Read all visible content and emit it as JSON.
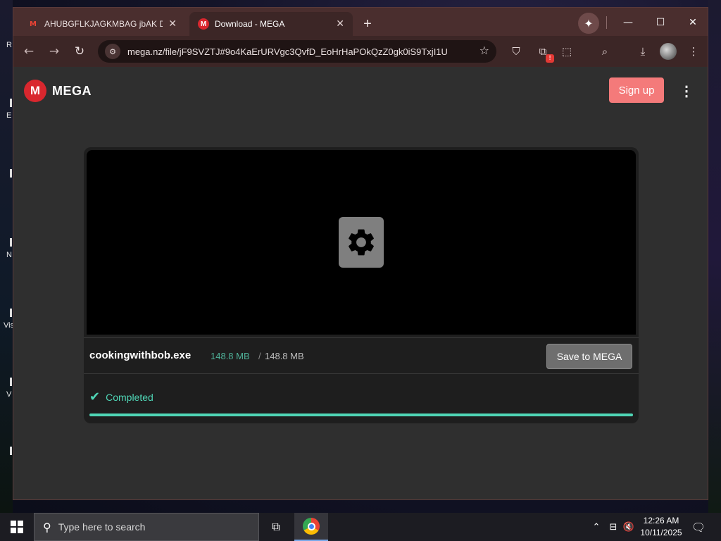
{
  "desktop": {
    "labels": [
      "R",
      "E",
      "N",
      "Vis",
      "V"
    ]
  },
  "browser": {
    "tabs": [
      {
        "title": "AHUBGFLKJAGKMBAG jbAK DIY",
        "icon": "gmail-icon"
      },
      {
        "title": "Download - MEGA",
        "icon": "mega-icon",
        "active": true
      }
    ],
    "new_tab_label": "+",
    "url": "mega.nz/file/jF9SVZTJ#9o4KaErURVgc3QvfD_EoHrHaPOkQzZ0gk0iS9TxjI1U"
  },
  "page": {
    "logo_text": "MEGA",
    "logo_mark": "M",
    "signup_label": "Sign up",
    "file": {
      "name": "cookingwithbob.exe",
      "downloaded": "148.8 MB",
      "separator": "/",
      "total": "148.8 MB",
      "save_label": "Save to MEGA"
    },
    "status": {
      "text": "Completed",
      "progress": 1.0
    }
  },
  "taskbar": {
    "search_placeholder": "Type here to search",
    "time": "12:26 AM",
    "date": "10/11/2025"
  },
  "colors": {
    "mega_red": "#d9272e",
    "signup": "#f47a7a",
    "success": "#4fd6b6",
    "size_green": "#4fb39a"
  }
}
